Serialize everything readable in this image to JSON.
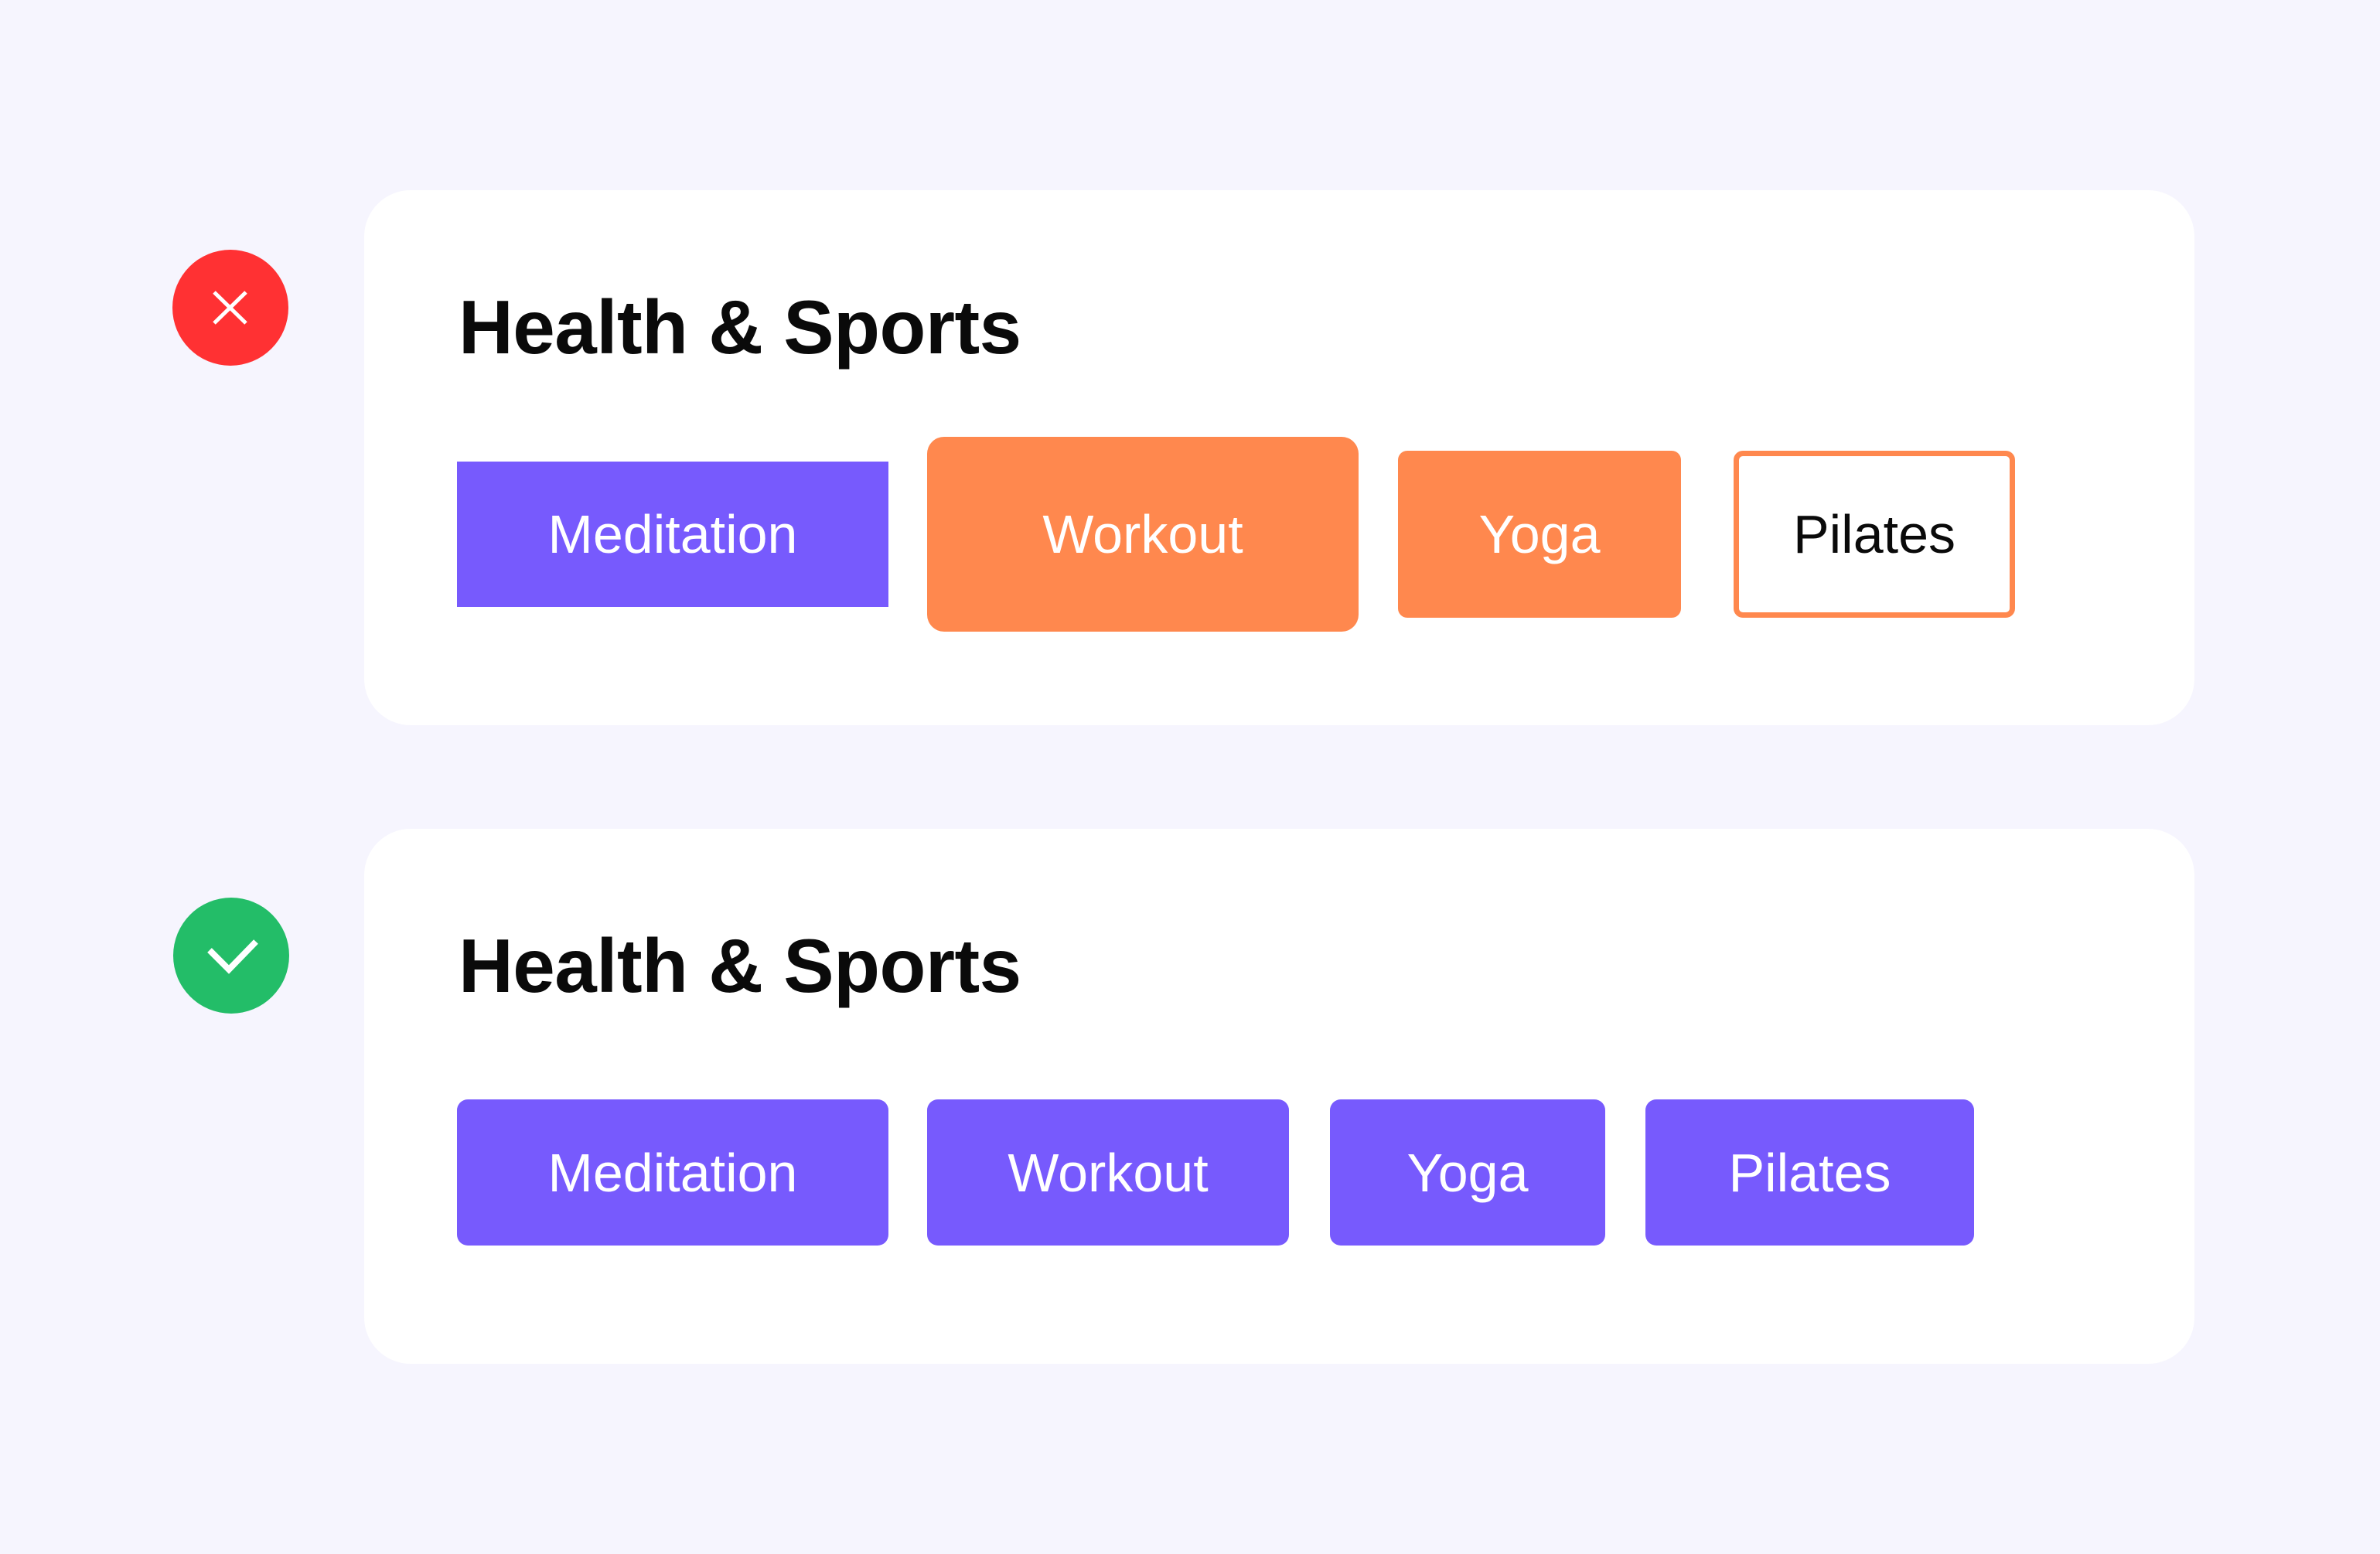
{
  "colors": {
    "background": "#f6f5fe",
    "card": "#ffffff",
    "primary_purple": "#775afd",
    "accent_orange": "#ff884e",
    "error_red": "#ff3133",
    "success_green": "#23bd68",
    "text_dark": "#0a0a0a"
  },
  "examples": [
    {
      "verdict": "incorrect",
      "icon": "x-icon",
      "title": "Health & Sports",
      "chips": [
        {
          "label": "Meditation",
          "style": "purple-square"
        },
        {
          "label": "Workout",
          "style": "orange-large-rounded"
        },
        {
          "label": "Yoga",
          "style": "orange-rounded"
        },
        {
          "label": "Pilates",
          "style": "orange-outline"
        }
      ]
    },
    {
      "verdict": "correct",
      "icon": "check-icon",
      "title": "Health & Sports",
      "chips": [
        {
          "label": "Meditation",
          "style": "purple-rounded"
        },
        {
          "label": "Workout",
          "style": "purple-rounded"
        },
        {
          "label": "Yoga",
          "style": "purple-rounded"
        },
        {
          "label": "Pilates",
          "style": "purple-rounded"
        }
      ]
    }
  ]
}
